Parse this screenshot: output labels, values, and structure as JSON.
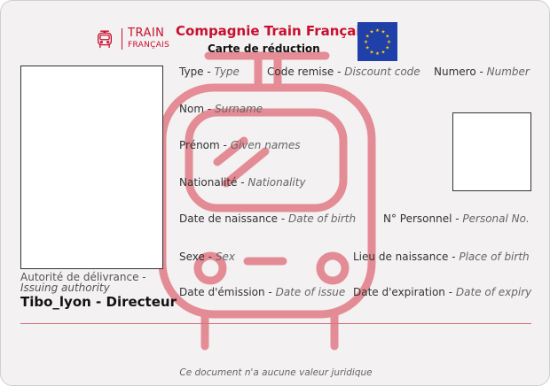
{
  "header": {
    "logo_line1": "TRAIN",
    "logo_line2": "FRANÇAIS",
    "company": "Compagnie Train Français",
    "subtitle": "Carte de réduction"
  },
  "fields": {
    "type": {
      "fr": "Type",
      "en": "Type"
    },
    "code": {
      "fr": "Code remise",
      "en": "Discount code"
    },
    "numero": {
      "fr": "Numero",
      "en": "Number"
    },
    "nom": {
      "fr": "Nom",
      "en": "Surname"
    },
    "prenom": {
      "fr": "Prénom",
      "en": "Given names"
    },
    "nationalite": {
      "fr": "Nationalité",
      "en": "Nationality"
    },
    "naissance": {
      "fr": "Date de naissance",
      "en": "Date of birth"
    },
    "personnel": {
      "fr": "N° Personnel",
      "en": "Personal No."
    },
    "sexe": {
      "fr": "Sexe",
      "en": "Sex"
    },
    "lieu": {
      "fr": "Lieu de naissance",
      "en": "Place of birth"
    },
    "emission": {
      "fr": "Date d'émission",
      "en": "Date of issue"
    },
    "expiration": {
      "fr": "Date d'expiration",
      "en": "Date of expiry"
    }
  },
  "authority": {
    "fr": "Autorité de délivrance -",
    "en": "Issuing authority",
    "value": "Tibo_lyon - Directeur"
  },
  "footer": {
    "disclaimer": "Ce document n'a aucune valeur juridique"
  },
  "colors": {
    "brand_red": "#c8102e",
    "eu_blue": "#1f40a8",
    "eu_star": "#ffcc00"
  },
  "icons": [
    "train-logo-icon",
    "train-watermark-icon",
    "eu-flag-icon"
  ]
}
